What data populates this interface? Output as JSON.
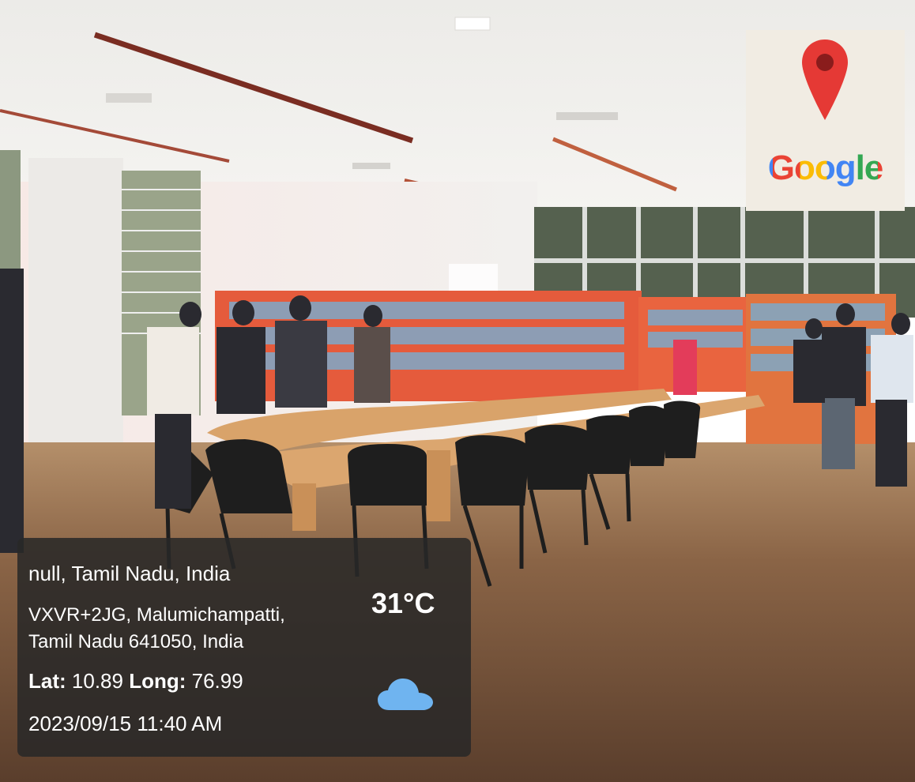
{
  "logo": {
    "text": "Google",
    "icon": "map-pin-icon"
  },
  "overlay": {
    "location_title": "null, Tamil Nadu, India",
    "address_line1": "VXVR+2JG, Malumichampatti,",
    "address_line2": "Tamil Nadu 641050, India",
    "lat_label": "Lat:",
    "lat_value": "10.89",
    "long_label": "Long:",
    "long_value": "76.99",
    "datetime": "2023/09/15 11:40 AM",
    "temperature": "31°C",
    "weather_icon": "cloud-icon"
  },
  "colors": {
    "pin_red": "#e53935",
    "cloud_blue": "#6fb4f0",
    "shelf_red": "#e55b3c",
    "floor_brown": "#6b4c36"
  }
}
